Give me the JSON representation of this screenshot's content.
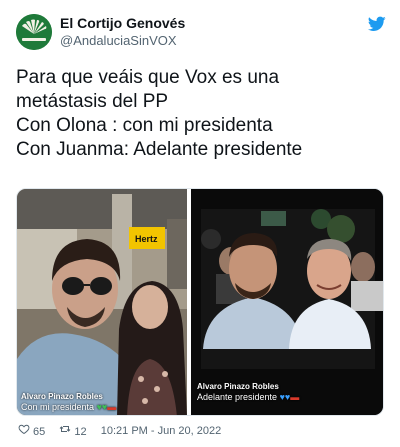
{
  "tweet": {
    "display_name": "El Cortijo Genovés",
    "handle": "@AndaluciaSinVOX",
    "text_lines": [
      "Para que veáis que Vox es una",
      "metástasis del PP",
      "Con Olona : con mi presidenta",
      "Con Juanma: Adelante presidente"
    ],
    "likes": "65",
    "retweets": "12",
    "timestamp": "10:21 PM - Jun 20, 2022"
  },
  "media": {
    "left_photo": {
      "caption_name": "Alvaro Pinazo Robles",
      "caption_text": "Con mi presidenta",
      "sign_text": "Hertz"
    },
    "right_photo": {
      "caption_name": "Alvaro Pinazo Robles",
      "caption_text": "Adelante presidente"
    }
  },
  "icons": {
    "avatar": "fan-logo-icon",
    "brand": "twitter-bird-icon",
    "like": "heart-icon",
    "retweet": "retweet-icon"
  },
  "colors": {
    "twitter_blue": "#1d9bf0",
    "avatar_green": "#1f7a3a",
    "text_secondary": "#536471"
  }
}
